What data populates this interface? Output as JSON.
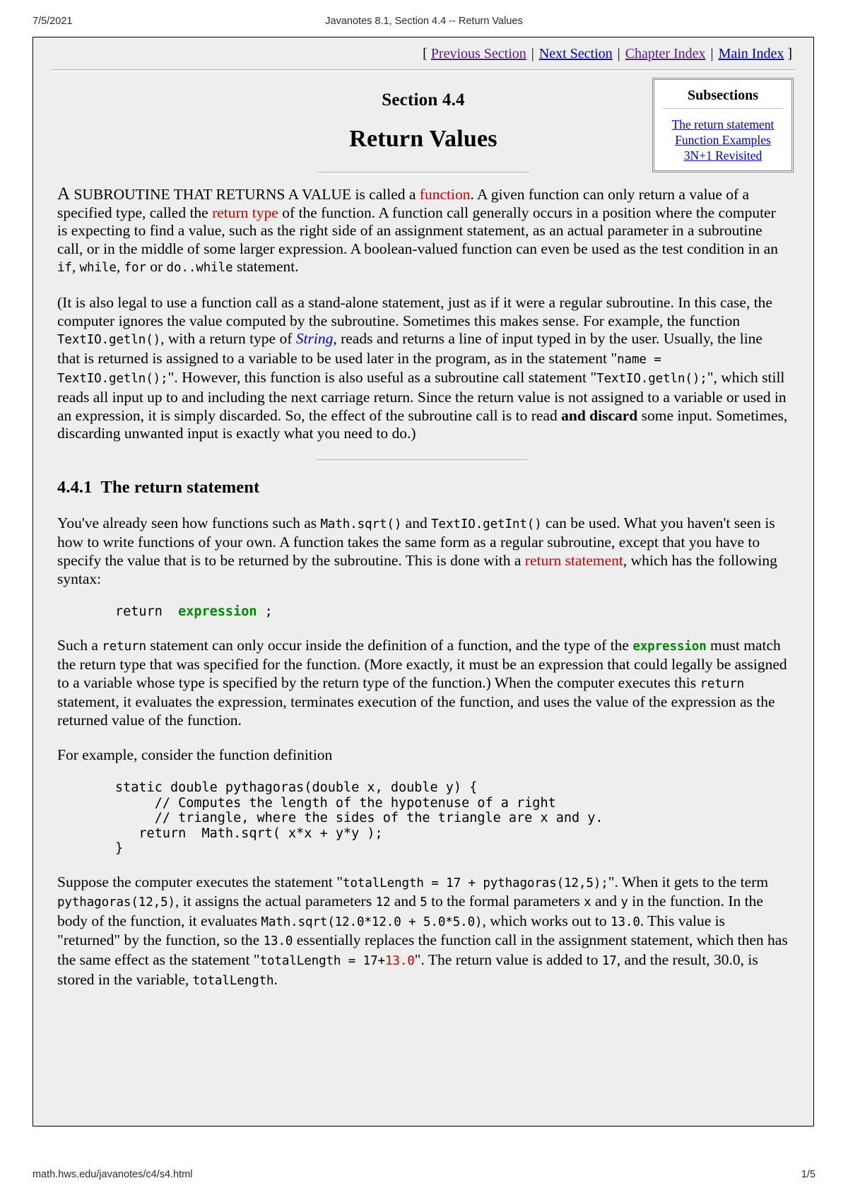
{
  "print": {
    "date": "7/5/2021",
    "doc_title": "Javanotes 8.1, Section 4.4 -- Return Values",
    "url": "math.hws.edu/javanotes/c4/s4.html",
    "page": "1/5"
  },
  "nav": {
    "open_bracket": "[",
    "close_bracket": "]",
    "separator": "|",
    "links": [
      {
        "label": "Previous Section",
        "state": "visited"
      },
      {
        "label": "Next Section",
        "state": "unvisited"
      },
      {
        "label": "Chapter Index",
        "state": "visited"
      },
      {
        "label": "Main Index",
        "state": "unvisited"
      }
    ]
  },
  "title": {
    "section_number": "Section 4.4",
    "section_name": "Return Values"
  },
  "subsections": {
    "heading": "Subsections",
    "items": [
      "The return statement",
      "Function Examples",
      "3N+1 Revisited"
    ]
  },
  "intro": {
    "p1": {
      "lead_cap": "A",
      "small_caps": " SUBROUTINE THAT RETURNS A VALUE",
      "t1": " is called a ",
      "kw1": "function",
      "t2": ". A given function can only return a value of a specified type, called the ",
      "kw2": "return type",
      "t3": " of the function. A function call generally occurs in a position where the computer is expecting to find a value, such as the right side of an assignment statement, as an actual parameter in a subroutine call, or in the middle of some larger expression. A boolean-valued function can even be used as the test condition in an ",
      "c1": "if",
      "t4": ", ",
      "c2": "while",
      "t5": ", ",
      "c3": "for",
      "t6": " or ",
      "c4": "do..while",
      "t7": " statement."
    },
    "p2": {
      "t1": "(It is also legal to use a function call as a stand-alone statement, just as if it were a regular subroutine. In this case, the computer ignores the value computed by the subroutine. Sometimes this makes sense. For example, the function ",
      "c1": "TextIO.getln()",
      "t2": ", with a return type of ",
      "link1": "String",
      "t3": ", reads and returns a line of input typed in by the user. Usually, the line that is returned is assigned to a variable to be used later in the program, as in the statement \"",
      "c2": "name = TextIO.getln();",
      "t4": "\". However, this function is also useful as a subroutine call statement \"",
      "c3": "TextIO.getln();",
      "t5": "\", which still reads all input up to and including the next carriage return. Since the return value is not assigned to a variable or used in an expression, it is simply discarded. So, the effect of the subroutine call is to read ",
      "b1": "and discard",
      "t6": " some input. Sometimes, discarding unwanted input is exactly what you need to do.)"
    }
  },
  "subsection1": {
    "number": "4.4.1",
    "heading": "The return statement",
    "p1": {
      "t1": "You've already seen how functions such as ",
      "c1": "Math.sqrt()",
      "t2": " and ",
      "c2": "TextIO.getInt()",
      "t3": " can be used. What you haven't seen is how to write functions of your own. A function takes the same form as a regular subroutine, except that you have to specify the value that is to be returned by the subroutine. This is done with a ",
      "kw1": "return statement",
      "t4": ", which has the following syntax:"
    },
    "syntax_code": {
      "part1": "return  ",
      "part2": "expression",
      "part3": " ;"
    },
    "p2": {
      "t1": "Such a ",
      "c1": "return",
      "t2": " statement can only occur inside the definition of a function, and the type of the ",
      "g1": "expression",
      "t3": " must match the return type that was specified for the function. (More exactly, it must be an expression that could legally be assigned to a variable whose type is specified by the return type of the function.) When the computer executes this ",
      "c2": "return",
      "t4": " statement, it evaluates the expression, terminates execution of the function, and uses the value of the expression as the returned value of the function."
    },
    "p3": "For example, consider the function definition",
    "example_code": "static double pythagoras(double x, double y) {\n     // Computes the length of the hypotenuse of a right\n     // triangle, where the sides of the triangle are x and y.\n   return  Math.sqrt( x*x + y*y );\n}",
    "p4": {
      "t1": "Suppose the computer executes the statement \"",
      "c1": "totalLength = 17 + pythagoras(12,5);",
      "t2": "\". When it gets to the term ",
      "c2": "pythagoras(12,5)",
      "t3": ", it assigns the actual parameters ",
      "c3": "12",
      "t4": " and ",
      "c4": "5",
      "t5": " to the formal parameters ",
      "c5": "x",
      "t6": " and ",
      "c6": "y",
      "t7": " in the function. In the body of the function, it evaluates ",
      "c7": "Math.sqrt(12.0*12.0 + 5.0*5.0)",
      "t8": ", which works out to ",
      "c8": "13.0",
      "t9": ". This value is \"returned\" by the function, so the ",
      "c9": "13.0",
      "t10": " essentially replaces the function call in the assignment statement, which then has the same effect as the statement \"",
      "c10": "totalLength = 17+",
      "c10r": "13.0",
      "t11": "\". The return value is added to ",
      "c11": "17",
      "t12": ", and the result, 30.0, is stored in the variable, ",
      "c12": "totalLength",
      "t13": "."
    }
  },
  "colors": {
    "keyword_red": "#cc0000",
    "link_blue": "#0000cc",
    "link_visited": "#551a8b",
    "code_green": "#008800",
    "page_bg": "#eeeeee"
  }
}
